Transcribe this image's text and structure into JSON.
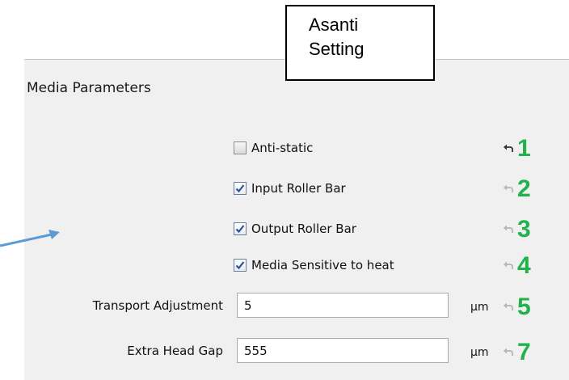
{
  "callout": {
    "line1": "Asanti",
    "line2": "Setting"
  },
  "section": {
    "title": "Media Parameters"
  },
  "checkboxes": [
    {
      "label": "Anti-static",
      "checked": false,
      "number": "1"
    },
    {
      "label": "Input Roller Bar",
      "checked": true,
      "number": "2"
    },
    {
      "label": "Output Roller Bar",
      "checked": true,
      "number": "3"
    },
    {
      "label": "Media Sensitive to heat",
      "checked": true,
      "number": "4"
    }
  ],
  "fields": [
    {
      "label": "Transport Adjustment",
      "value": "5",
      "unit": "µm",
      "number": "5"
    },
    {
      "label": "Extra Head Gap",
      "value": "555",
      "unit": "µm",
      "number": "7"
    }
  ],
  "colors": {
    "number": "#22b14c",
    "arrow": "#5b9bd5",
    "panel": "#f0f0f0"
  },
  "icons": {
    "reset": "undo-arrow-icon",
    "pointer": "arrow-pointer-icon"
  }
}
